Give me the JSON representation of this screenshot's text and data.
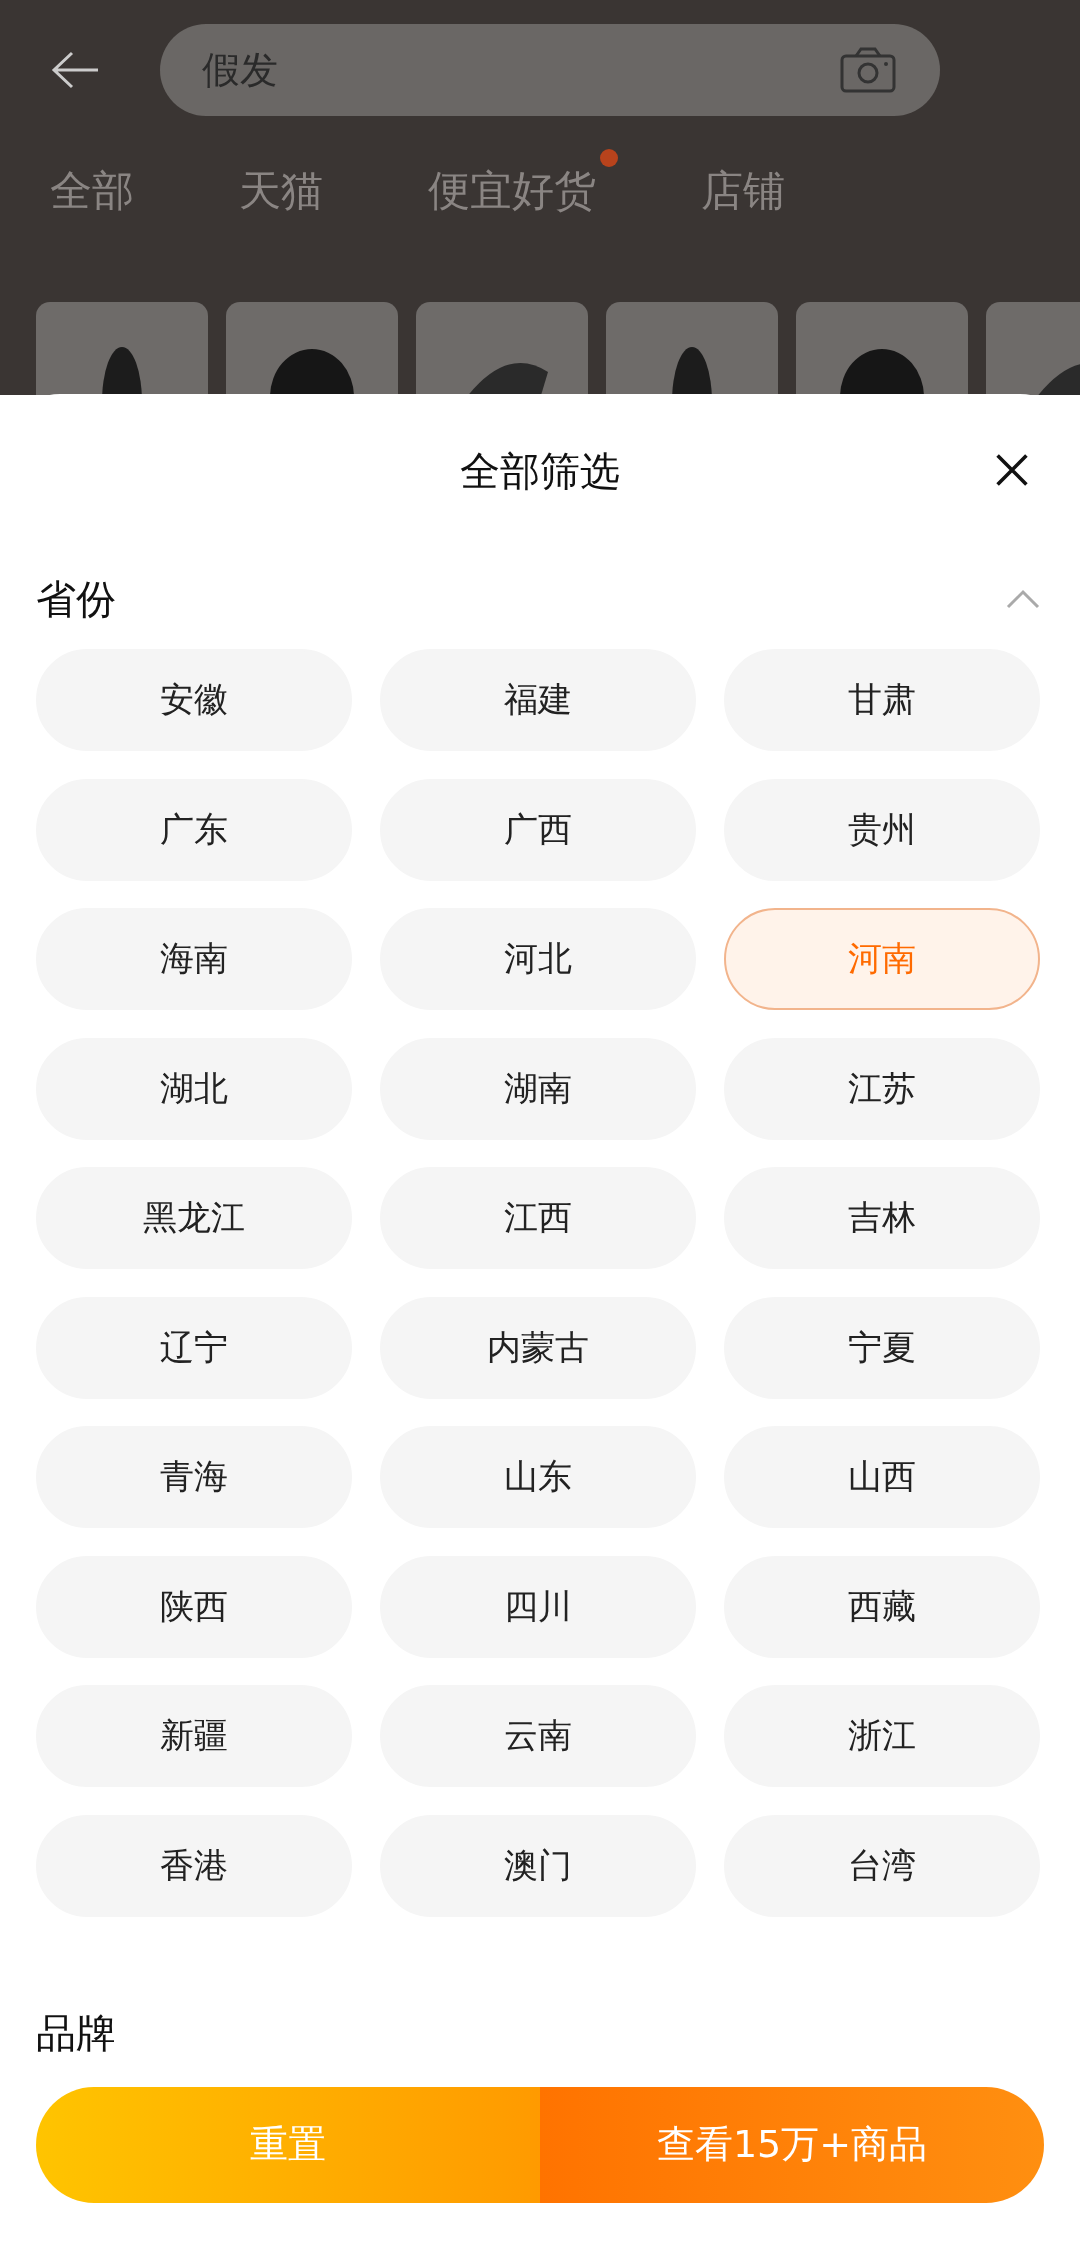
{
  "search": {
    "value": "假发"
  },
  "tabs": [
    {
      "label": "全部",
      "dot": false
    },
    {
      "label": "天猫",
      "dot": false
    },
    {
      "label": "便宜好货",
      "dot": true
    },
    {
      "label": "店铺",
      "dot": false
    }
  ],
  "sheet": {
    "title": "全部筛选",
    "province": {
      "title": "省份",
      "expanded": true,
      "options": [
        {
          "label": "安徽",
          "selected": false
        },
        {
          "label": "福建",
          "selected": false
        },
        {
          "label": "甘肃",
          "selected": false
        },
        {
          "label": "广东",
          "selected": false
        },
        {
          "label": "广西",
          "selected": false
        },
        {
          "label": "贵州",
          "selected": false
        },
        {
          "label": "海南",
          "selected": false
        },
        {
          "label": "河北",
          "selected": false
        },
        {
          "label": "河南",
          "selected": true
        },
        {
          "label": "湖北",
          "selected": false
        },
        {
          "label": "湖南",
          "selected": false
        },
        {
          "label": "江苏",
          "selected": false
        },
        {
          "label": "黑龙江",
          "selected": false
        },
        {
          "label": "江西",
          "selected": false
        },
        {
          "label": "吉林",
          "selected": false
        },
        {
          "label": "辽宁",
          "selected": false
        },
        {
          "label": "内蒙古",
          "selected": false
        },
        {
          "label": "宁夏",
          "selected": false
        },
        {
          "label": "青海",
          "selected": false
        },
        {
          "label": "山东",
          "selected": false
        },
        {
          "label": "山西",
          "selected": false
        },
        {
          "label": "陕西",
          "selected": false
        },
        {
          "label": "四川",
          "selected": false
        },
        {
          "label": "西藏",
          "selected": false
        },
        {
          "label": "新疆",
          "selected": false
        },
        {
          "label": "云南",
          "selected": false
        },
        {
          "label": "浙江",
          "selected": false
        },
        {
          "label": "香港",
          "selected": false
        },
        {
          "label": "澳门",
          "selected": false
        },
        {
          "label": "台湾",
          "selected": false
        }
      ]
    },
    "brand": {
      "title": "品牌"
    },
    "buttons": [
      {
        "kind": "reset",
        "label": "重置"
      },
      {
        "kind": "confirm",
        "label": "查看15万+商品"
      }
    ]
  }
}
